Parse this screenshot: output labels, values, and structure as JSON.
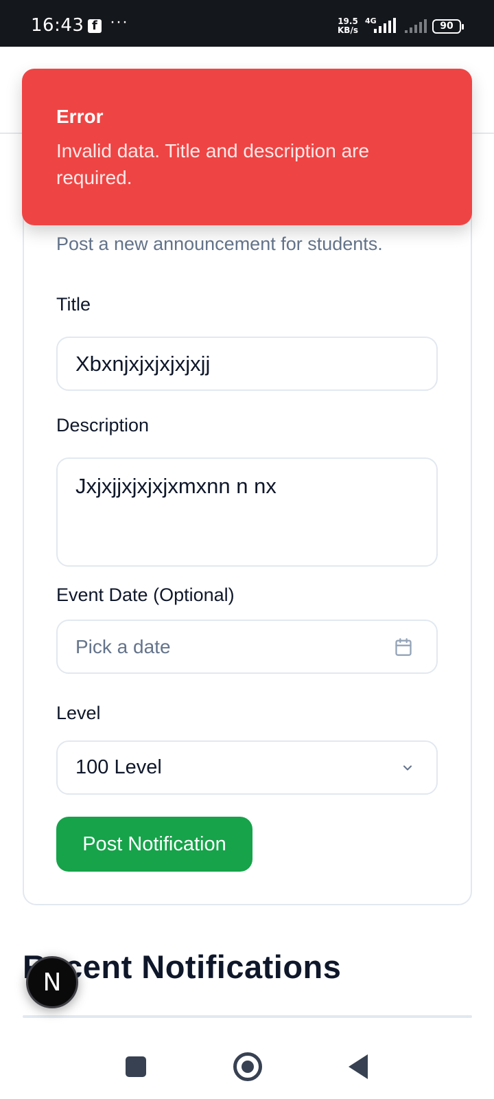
{
  "status_bar": {
    "time": "16:43",
    "notification_icon": "facebook-icon",
    "more": "···",
    "net_speed_value": "19.5",
    "net_speed_unit": "KB/s",
    "network_type": "4G",
    "battery": "90"
  },
  "toast": {
    "title": "Error",
    "message": "Invalid data. Title and description are required.",
    "color": "#ef4444"
  },
  "form": {
    "subtitle": "Post a new announcement for students.",
    "title_label": "Title",
    "title_value": "Xbxnjxjxjxjxjxjj",
    "description_label": "Description",
    "description_value": "Jxjxjjxjxjxjxmxnn n nx",
    "event_date_label": "Event Date (Optional)",
    "event_date_placeholder": "Pick a date",
    "level_label": "Level",
    "level_value": "100 Level",
    "submit_label": "Post Notification",
    "submit_color": "#16a34a"
  },
  "recent": {
    "title": "Recent Notifications"
  },
  "dev_badge": {
    "letter": "N"
  }
}
